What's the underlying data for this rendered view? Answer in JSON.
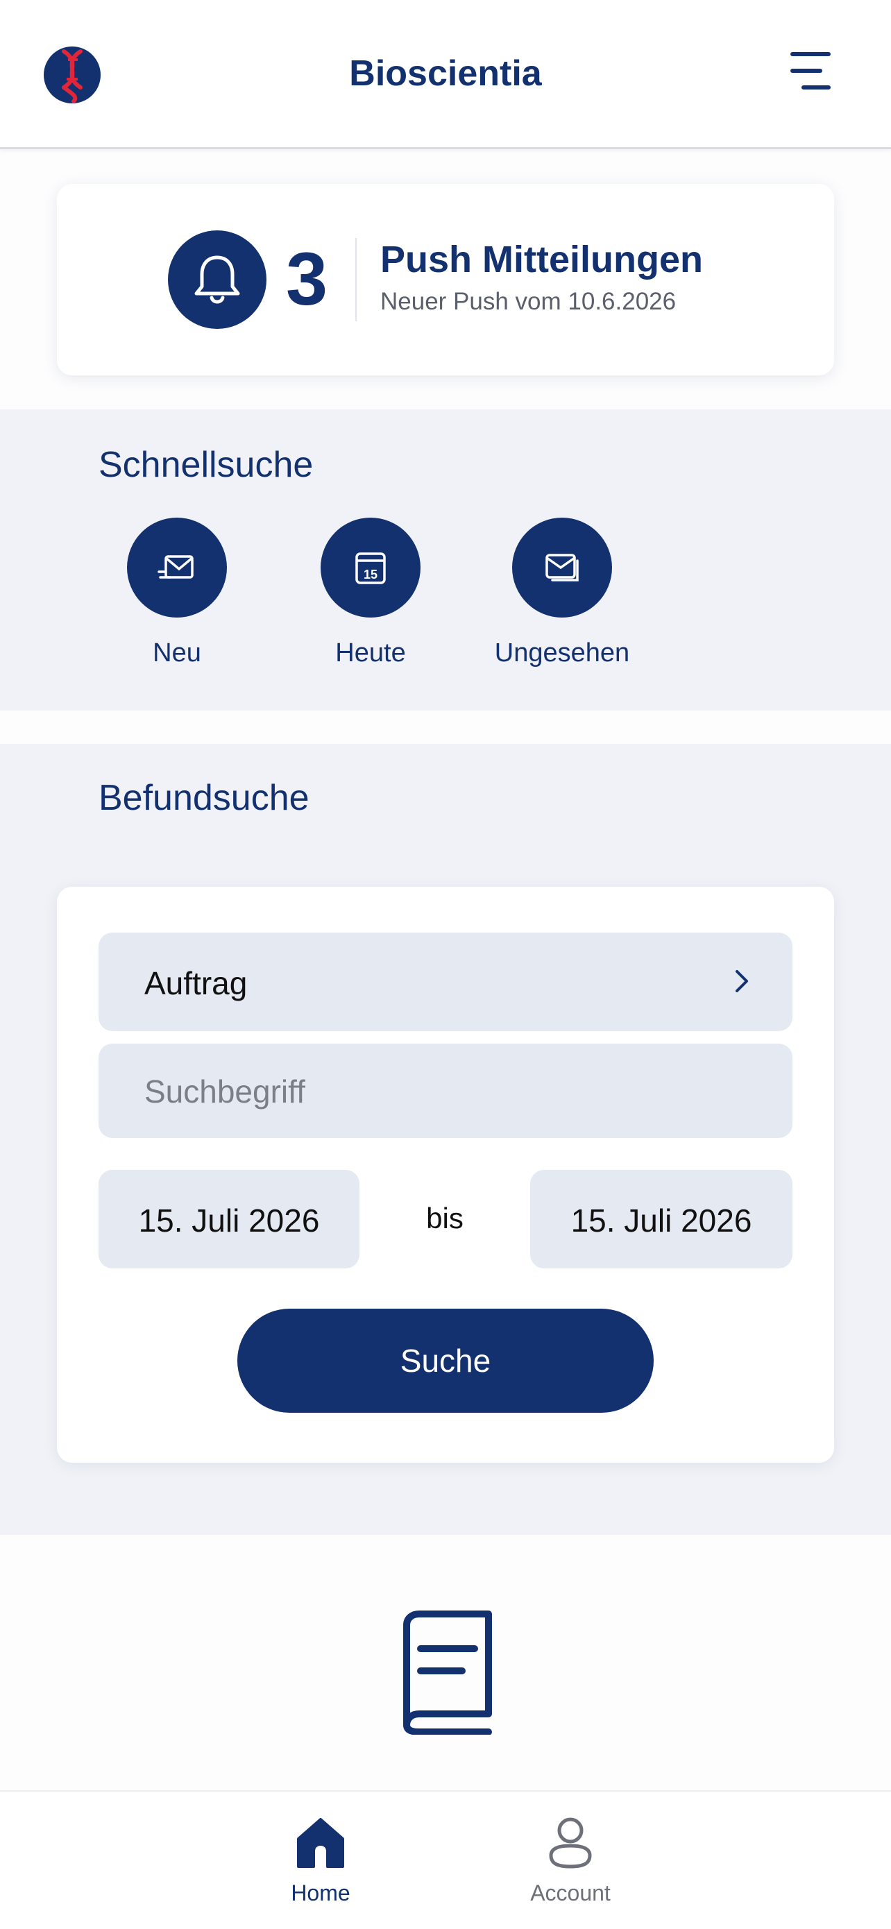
{
  "header": {
    "title": "Bioscientia",
    "logo_icon": "dna-logo-icon",
    "menu_icon": "hamburger-menu-icon"
  },
  "push": {
    "icon": "bell-icon",
    "count": "3",
    "title": "Push Mitteilungen",
    "subtitle": "Neuer Push vom 10.6.2026"
  },
  "quick_search": {
    "title": "Schnellsuche",
    "items": [
      {
        "label": "Neu",
        "icon": "new-mail-icon"
      },
      {
        "label": "Heute",
        "icon": "calendar-icon",
        "calendar_day": "15"
      },
      {
        "label": "Ungesehen",
        "icon": "unread-mail-icon"
      }
    ]
  },
  "report_search": {
    "title": "Befundsuche",
    "order_label": "Auftrag",
    "search_placeholder": "Suchbegriff",
    "date_from": "15. Juli 2026",
    "range_separator": "bis",
    "date_to": "15. Juli 2026",
    "search_button": "Suche"
  },
  "tabs": [
    {
      "label": "Home",
      "icon": "home-icon",
      "active": true
    },
    {
      "label": "Account",
      "icon": "account-icon",
      "active": false
    }
  ],
  "colors": {
    "primary": "#13316e",
    "section_bg": "#f0f2f7",
    "field_bg": "#e5e9f2",
    "logo_red": "#e0263a"
  }
}
